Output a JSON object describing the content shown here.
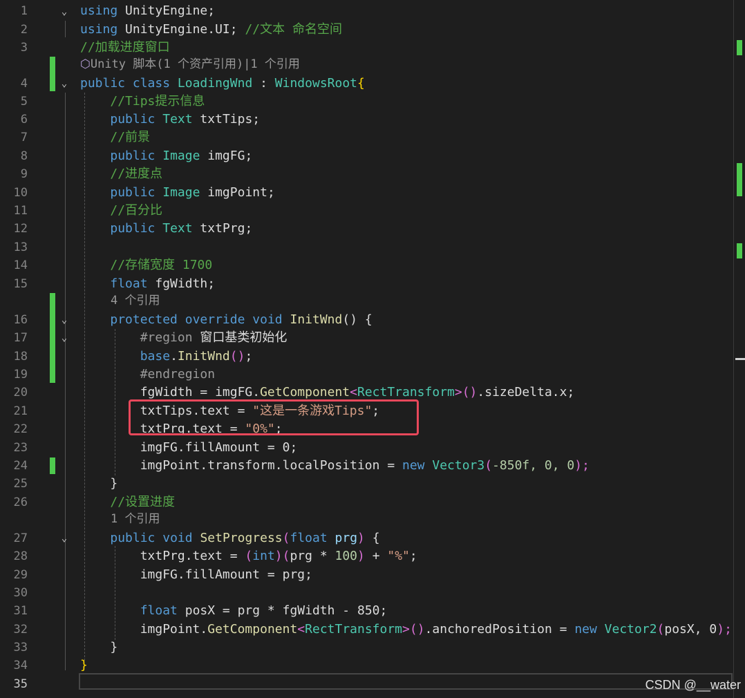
{
  "editor": {
    "line_numbers": [
      "1",
      "2",
      "3",
      "4",
      "5",
      "6",
      "7",
      "8",
      "9",
      "10",
      "11",
      "12",
      "13",
      "14",
      "15",
      "16",
      "17",
      "18",
      "19",
      "20",
      "21",
      "22",
      "23",
      "24",
      "25",
      "26",
      "27",
      "28",
      "29",
      "30",
      "31",
      "32",
      "33",
      "34",
      "35"
    ],
    "codelens": {
      "class_refs": "Unity 脚本(1 个资产引用)|1 个引用",
      "initwnd_refs": "4 个引用",
      "setprogress_refs": "1 个引用"
    },
    "tokens": {
      "using": "using",
      "unity_engine": "UnityEngine",
      "unity_engine_ui": "UnityEngine.UI",
      "semicolon": ";",
      "comment_namespace": "//文本 命名空间",
      "comment_load_window": "//加载进度窗口",
      "public": "public",
      "class": "class",
      "class_name": "LoadingWnd",
      "colon": " : ",
      "base_class": "WindowsRoot",
      "open_brace": "{",
      "close_brace": "}",
      "comment_tips": "//Tips提示信息",
      "text_type": "Text",
      "image_type": "Image",
      "txtTips_decl": " txtTips;",
      "comment_fg": "//前景",
      "imgFG_decl": " imgFG;",
      "comment_point": "//进度点",
      "imgPoint_decl": " imgPoint;",
      "comment_percent": "//百分比",
      "txtPrg_decl": " txtPrg;",
      "comment_store_width": "//存储宽度 1700",
      "float": "float",
      "fgWidth_decl": " fgWidth;",
      "protected": "protected",
      "override": "override",
      "void": "void",
      "initwnd": "InitWnd",
      "parens": "()",
      "sp_brace": " {",
      "region": "#region",
      "region_label": " 窗口基类初始化",
      "base": "base",
      "dot": ".",
      "endregion": "#endregion",
      "fgWidth_assign": "fgWidth = imgFG.",
      "get_component": "GetComponent",
      "lt": "<",
      "gt": ">",
      "rect_transform": "RectTransform",
      "size_delta": ".sizeDelta.x;",
      "txtTips_text": "txtTips.text = ",
      "tips_string": "\"这是一条游戏Tips\"",
      "txtPrg_text": "txtPrg.text = ",
      "zero_percent_string": "\"0%\"",
      "fill_zero": "imgFG.fillAmount = 0;",
      "imgPoint_transform": "imgPoint.transform.localPosition = ",
      "new": "new",
      "vector3": "Vector3",
      "open_paren": "(",
      "close_paren": ")",
      "neg850f": "-850f",
      "comma_zero": ", 0, 0",
      "paren_semi": ");",
      "comment_set_progress": "//设置进度",
      "set_progress": "SetProgress",
      "prg_param": " prg",
      "int_kw": "int",
      "prg_times": "prg * ",
      "hundred": "100",
      "plus": " + ",
      "percent_string": "\"%\"",
      "fill_prg": "imgFG.fillAmount = prg;",
      "posx_decl": " posX = prg * fgWidth - 850;",
      "imgPoint_dot": "imgPoint.",
      "anchored": ".anchoredPosition = ",
      "vector2": "Vector2",
      "posx_zero": "posX, 0"
    }
  },
  "watermark": "CSDN @__water"
}
